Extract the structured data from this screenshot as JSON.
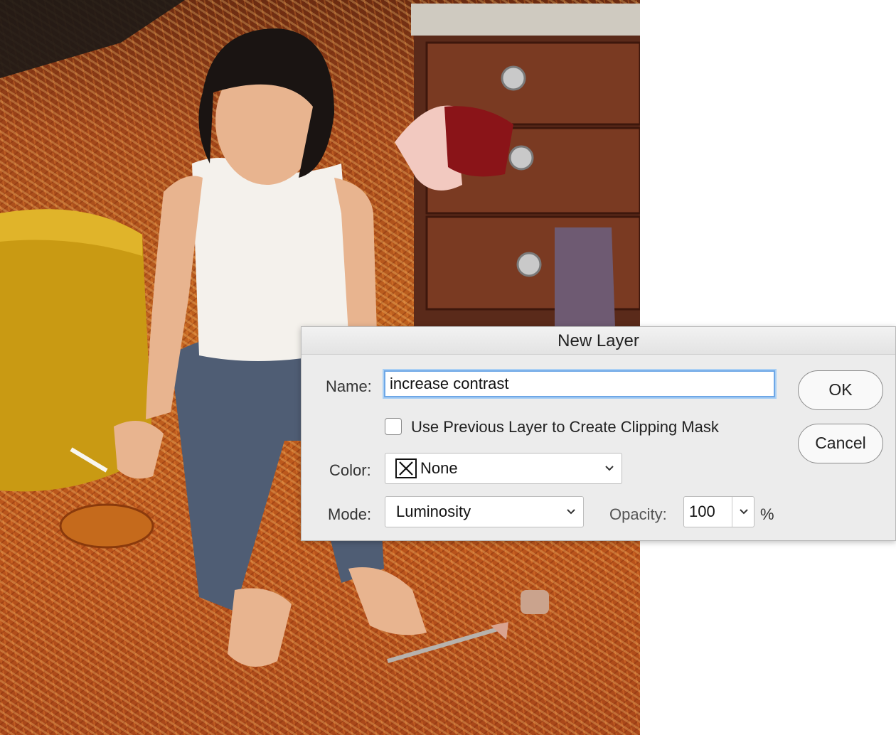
{
  "dialog": {
    "title": "New Layer",
    "name_label": "Name:",
    "name_value": "increase contrast",
    "clip_label": "Use Previous Layer to Create Clipping Mask",
    "clip_checked": false,
    "color_label": "Color:",
    "color_value": "None",
    "mode_label": "Mode:",
    "mode_value": "Luminosity",
    "opacity_label": "Opacity:",
    "opacity_value": "100",
    "opacity_unit": "%",
    "ok_label": "OK",
    "cancel_label": "Cancel"
  },
  "icons": {
    "color_swatch": "x-box-icon",
    "dropdown": "chevron-down-icon"
  },
  "colors": {
    "focus_ring": "#6ea7e6",
    "dialog_bg": "#ececec"
  }
}
